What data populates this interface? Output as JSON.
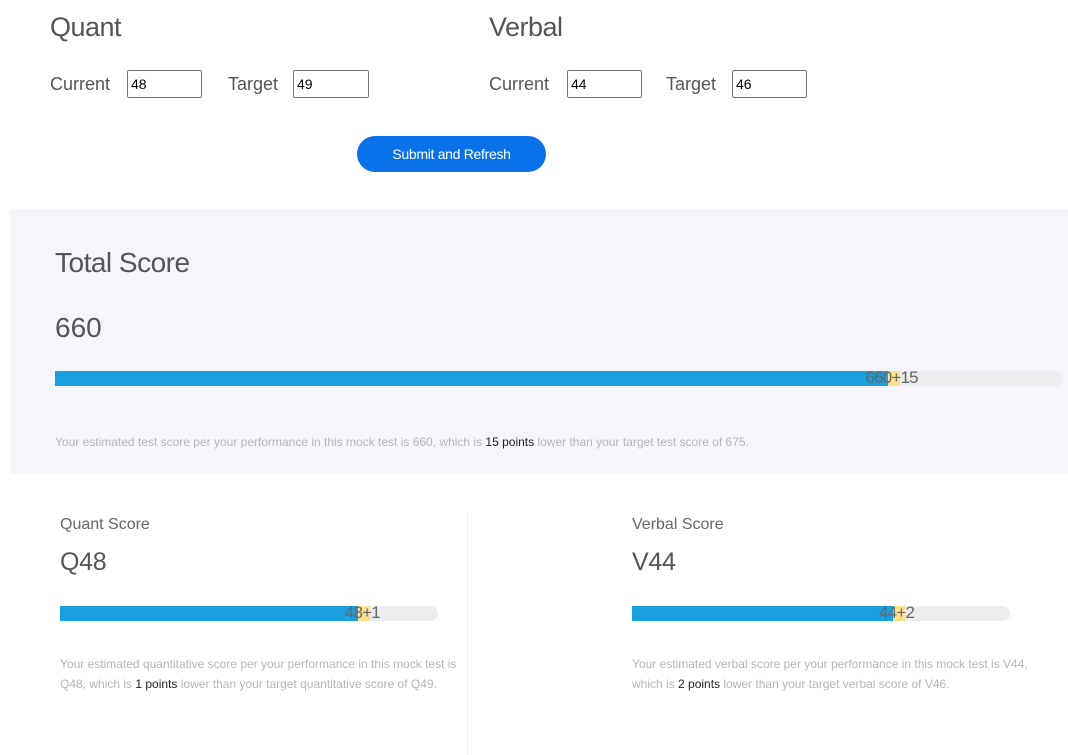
{
  "quant": {
    "title": "Quant",
    "current_label": "Current",
    "current_value": "48",
    "target_label": "Target",
    "target_value": "49"
  },
  "verbal": {
    "title": "Verbal",
    "current_label": "Current",
    "current_value": "44",
    "target_label": "Target",
    "target_value": "46"
  },
  "submit_label": "Submit and Refresh",
  "total": {
    "heading": "Total Score",
    "value": "660",
    "bar_current": "660",
    "bar_gap": "+15",
    "progress_fraction": 0.83,
    "summary_pre": "Your estimated test score per your performance in this mock test is 660, which is ",
    "summary_highlight": "15 points",
    "summary_post": " lower than your target test score of 675."
  },
  "quant_score": {
    "heading": "Quant Score",
    "value": "Q48",
    "bar_current": "48",
    "bar_gap": "+1",
    "progress_fraction": 0.8,
    "summary_pre": "Your estimated quantitative score per your performance in this mock test is Q48, which is ",
    "summary_highlight": "1 points",
    "summary_post": " lower than your target quantitative score of Q49."
  },
  "verbal_score": {
    "heading": "Verbal Score",
    "value": "V44",
    "bar_current": "44",
    "bar_gap": "+2",
    "progress_fraction": 0.7,
    "summary_pre": "Your estimated verbal score per your performance in this mock test is V44, which is ",
    "summary_highlight": "2 points",
    "summary_post": " lower than your target verbal score of V46."
  },
  "colors": {
    "primary_button": "#0a72e8",
    "progress_fill": "#1a9fe0",
    "gap_fill": "#fbe28a",
    "track": "#ededed",
    "panel_bg": "#f4f6fb"
  }
}
